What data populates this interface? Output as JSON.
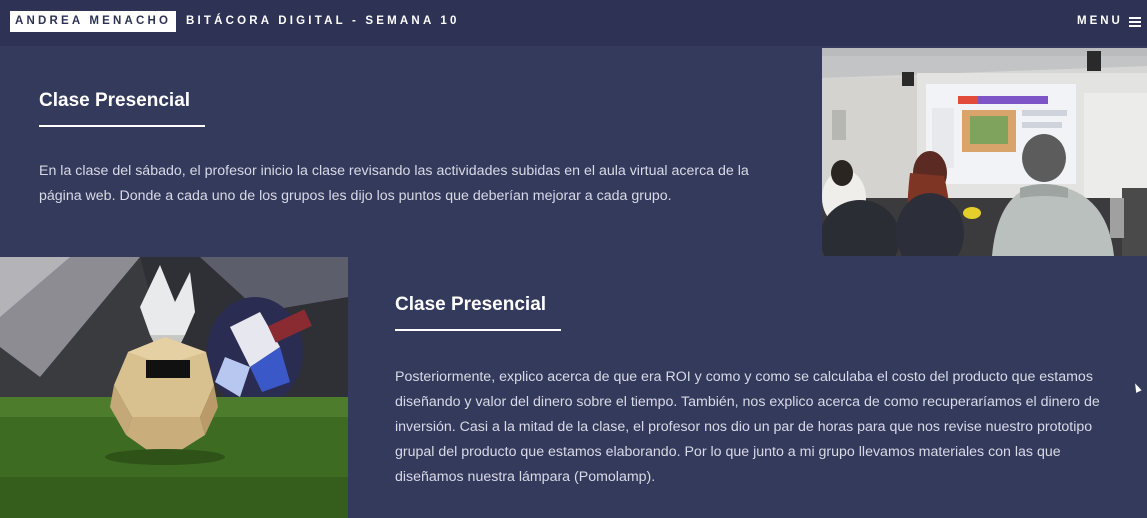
{
  "header": {
    "author": "ANDREA MENACHO",
    "site_title": "BITÁCORA DIGITAL - SEMANA 10",
    "menu_label": "MENU",
    "menu_icon": "hamburger-icon"
  },
  "sections": [
    {
      "heading": "Clase Presencial",
      "paragraph": "En la clase del sábado, el profesor inicio la clase revisando las actividades subidas en el aula virtual acerca de la página web. Donde a cada uno de los grupos les dijo los puntos que deberían mejorar a cada grupo.",
      "image": "classroom-photo"
    },
    {
      "heading": "Clase Presencial",
      "paragraph": "Posteriormente, explico acerca de que era ROI y como y como se calculaba el costo del producto que estamos diseñando y valor del dinero sobre el tiempo. También, nos explico acerca de como recuperaríamos el dinero de inversión. Casi a la mitad de la clase, el profesor nos dio un par de horas para que nos revise nuestro prototipo grupal del producto que estamos elaborando. Por lo que junto a mi grupo llevamos materiales con las que diseñamos nuestra lámpara (Pomolamp).",
      "image": "lamp-prototype-photo"
    }
  ],
  "colors": {
    "background": "#343a5c",
    "topbar": "#2e3355",
    "text": "#d8dae6",
    "heading": "#ffffff"
  }
}
